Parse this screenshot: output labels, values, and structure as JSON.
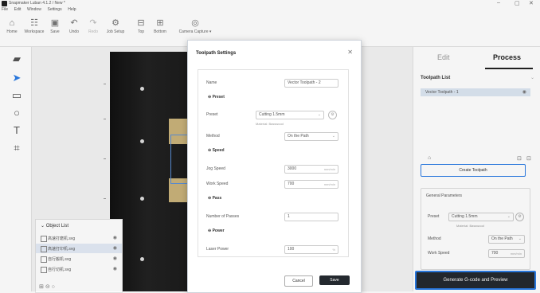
{
  "window": {
    "title": "Snapmaker Luban 4.1.2 / New *",
    "controls": [
      "–",
      "▢",
      "✕"
    ]
  },
  "menu": [
    "File",
    "Edit",
    "Window",
    "Settings",
    "Help"
  ],
  "toolbar": [
    {
      "label": "Home",
      "icon": "home-icon",
      "enabled": true
    },
    {
      "label": "Workspace",
      "icon": "workspace-icon",
      "enabled": true
    },
    {
      "label": "Save",
      "icon": "save-icon",
      "enabled": true
    },
    {
      "label": "Undo",
      "icon": "undo-icon",
      "enabled": true
    },
    {
      "label": "Redo",
      "icon": "redo-icon",
      "enabled": false
    },
    {
      "label": "Job Setup",
      "icon": "job-setup-icon",
      "enabled": true
    },
    {
      "label": "Top",
      "icon": "top-icon",
      "enabled": true
    },
    {
      "label": "Bottom",
      "icon": "bottom-icon",
      "enabled": true
    },
    {
      "label": "Camera Capture ▾",
      "icon": "camera-capture-icon",
      "enabled": true
    }
  ],
  "object_list": {
    "header": "Object List",
    "items": [
      {
        "name": "高速打磨机.svg"
      },
      {
        "name": "高速打印机.svg"
      },
      {
        "name": "自行搬机.svg"
      },
      {
        "name": "自行切机.svg"
      }
    ]
  },
  "right_panel": {
    "tabs": [
      "Edit",
      "Process"
    ],
    "toolpath_list_title": "Toolpath List",
    "toolpath_item": "Vector Toolpath - 1",
    "create_button": "Create Toolpath",
    "general_params": {
      "title": "General Parameters",
      "preset_label": "Preset",
      "preset_value": "Cutting 1.5mm",
      "material_hint": "Material: Basswood",
      "method_label": "Method",
      "method_value": "On the Path",
      "work_speed_label": "Work Speed",
      "work_speed_value": "700",
      "work_speed_unit": "mm/min"
    },
    "generate_button": "Generate G-code and Preview"
  },
  "dialog": {
    "title": "Toolpath Settings",
    "name_label": "Name",
    "name_value": "Vector Toolpath - 2",
    "preset_group": "Preset",
    "preset_label": "Preset",
    "preset_value": "Cutting 1.5mm",
    "material_hint": "Material: Basswood",
    "method_label": "Method",
    "method_value": "On the Path",
    "speed_group": "Speed",
    "jog_speed_label": "Jog Speed",
    "jog_speed_value": "3000",
    "jog_speed_unit": "mm/min",
    "work_speed_label": "Work Speed",
    "work_speed_value": "700",
    "work_speed_unit": "mm/min",
    "pass_group": "Pass",
    "passes_label": "Number of Passes",
    "passes_value": "1",
    "power_group": "Power",
    "laser_power_label": "Laser Power",
    "laser_power_value": "100",
    "laser_power_unit": "%",
    "cancel_button": "Cancel",
    "save_button": "Save"
  }
}
